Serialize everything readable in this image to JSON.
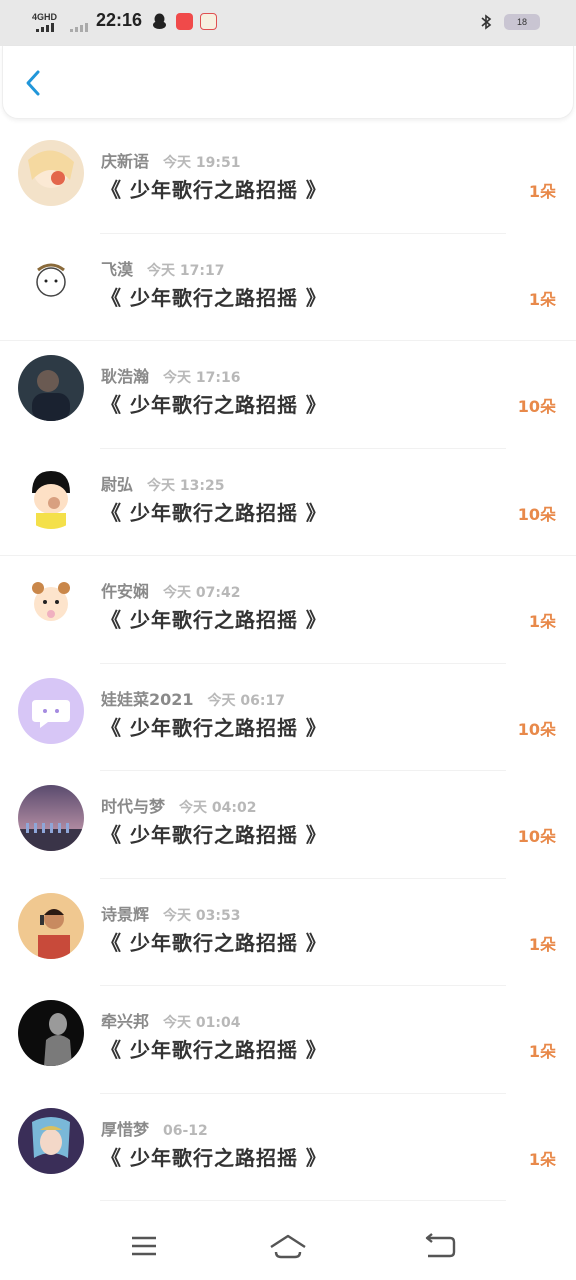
{
  "status_bar": {
    "network": "4GHD",
    "time": "22:16",
    "battery": "18",
    "icons": [
      "signal-icon",
      "qq-icon",
      "app-icon-1",
      "app-icon-2",
      "bluetooth-icon",
      "battery-icon"
    ]
  },
  "header": {
    "back_icon": "chevron-left-icon"
  },
  "rows": [
    {
      "name": "庆新语",
      "time": "今天 19:51",
      "title": "《 少年歌行之路招摇 》",
      "amount": "1朵"
    },
    {
      "name": "飞漠",
      "time": "今天 17:17",
      "title": "《 少年歌行之路招摇 》",
      "amount": "1朵"
    },
    {
      "name": "耿浩瀚",
      "time": "今天 17:16",
      "title": "《 少年歌行之路招摇 》",
      "amount": "10朵"
    },
    {
      "name": "尉弘",
      "time": "今天 13:25",
      "title": "《 少年歌行之路招摇 》",
      "amount": "10朵"
    },
    {
      "name": "仵安娴",
      "time": "今天 07:42",
      "title": "《 少年歌行之路招摇 》",
      "amount": "1朵"
    },
    {
      "name": "娃娃菜2021",
      "time": "今天 06:17",
      "title": "《 少年歌行之路招摇 》",
      "amount": "10朵"
    },
    {
      "name": "时代与梦",
      "time": "今天 04:02",
      "title": "《 少年歌行之路招摇 》",
      "amount": "10朵"
    },
    {
      "name": "诗景辉",
      "time": "今天 03:53",
      "title": "《 少年歌行之路招摇 》",
      "amount": "1朵"
    },
    {
      "name": "牵兴邦",
      "time": "今天 01:04",
      "title": "《 少年歌行之路招摇 》",
      "amount": "1朵"
    },
    {
      "name": "厚惜梦",
      "time": "06-12",
      "title": "《 少年歌行之路招摇 》",
      "amount": "1朵"
    }
  ],
  "colors": {
    "accent": "#e8894a",
    "back": "#2196d9",
    "name": "#8a8a8a",
    "title": "#333333"
  },
  "nav": {
    "icons": [
      "menu-icon",
      "home-icon",
      "back-nav-icon"
    ]
  }
}
